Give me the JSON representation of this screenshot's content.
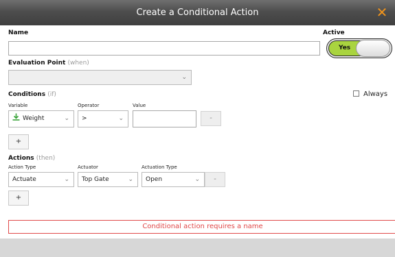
{
  "window": {
    "title": "Create a Conditional Action",
    "close_glyph": "✕",
    "close_color": "#f0941c"
  },
  "name": {
    "label": "Name",
    "value": ""
  },
  "active": {
    "label": "Active",
    "toggle_label": "Yes",
    "on": true,
    "on_color": "#a9d43f"
  },
  "evaluation_point": {
    "label": "Evaluation Point",
    "hint": "(when)",
    "selected": ""
  },
  "conditions": {
    "label": "Conditions",
    "hint": "(if)",
    "always_label": "Always",
    "always_checked": false,
    "columns": {
      "variable": "Variable",
      "operator": "Operator",
      "value": "Value"
    },
    "row": {
      "variable": "Weight",
      "variable_icon": "weight-download-icon",
      "operator": ">",
      "value": "",
      "remove": "-"
    },
    "add": "+"
  },
  "actions": {
    "label": "Actions",
    "hint": "(then)",
    "columns": {
      "action_type": "Action Type",
      "actuator": "Actuator",
      "actuation_type": "Actuation Type"
    },
    "row": {
      "action_type": "Actuate",
      "actuator": "Top Gate",
      "actuation_type": "Open",
      "remove": "-"
    },
    "add": "+"
  },
  "error": {
    "message": "Conditional action requires a name",
    "color": "#e04848"
  }
}
